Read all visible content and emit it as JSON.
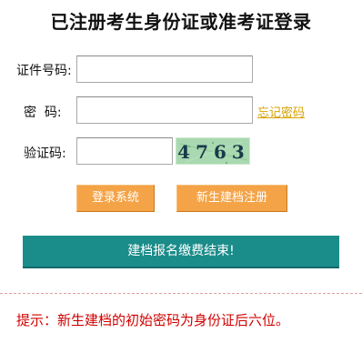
{
  "title": "已注册考生身份证或准考证登录",
  "form": {
    "id_label": "证件号码:",
    "id_value": "",
    "password_label": "密  码:",
    "password_value": "",
    "forgot_link": "忘记密码",
    "captcha_label": "验证码:",
    "captcha_value": "",
    "captcha_image_text": "4763"
  },
  "buttons": {
    "login": "登录系统",
    "register": "新生建档注册"
  },
  "banner": "建档报名缴费结束!",
  "tip": "提示：新生建档的初始密码为身份证后六位。",
  "colors": {
    "button_orange": "#f4a347",
    "banner_teal": "#1a8c8a",
    "tip_red": "#d10000",
    "link_gold": "#d8a100"
  }
}
